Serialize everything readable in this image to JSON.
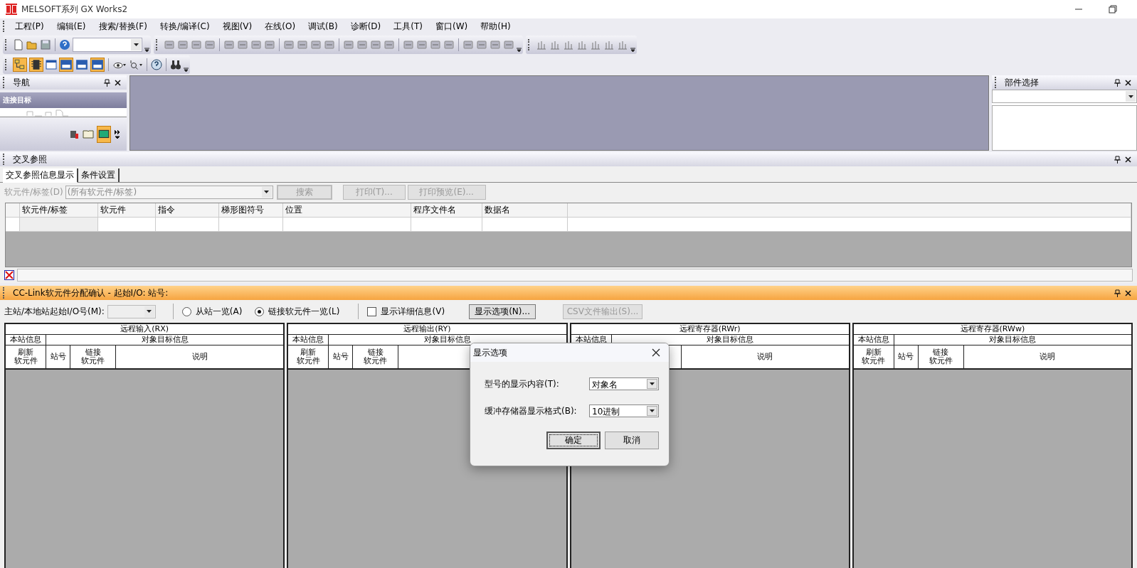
{
  "window": {
    "title": "MELSOFT系列 GX Works2"
  },
  "menu": [
    {
      "label": "工程(P)"
    },
    {
      "label": "编辑(E)"
    },
    {
      "label": "搜索/替换(F)"
    },
    {
      "label": "转换/编译(C)"
    },
    {
      "label": "视图(V)"
    },
    {
      "label": "在线(O)"
    },
    {
      "label": "调试(B)"
    },
    {
      "label": "诊断(D)"
    },
    {
      "label": "工具(T)"
    },
    {
      "label": "窗口(W)"
    },
    {
      "label": "帮助(H)"
    }
  ],
  "navigation": {
    "title": "导航",
    "section": "连接目标"
  },
  "parts_panel": {
    "title": "部件选择"
  },
  "cross_reference": {
    "title": "交叉参照",
    "tabs": [
      {
        "label": "交叉参照信息显示",
        "selected": true
      },
      {
        "label": "条件设置",
        "selected": false
      }
    ],
    "device_label": "软元件/标签(D)",
    "device_value": "(所有软元件/标签)",
    "device_disabled": true,
    "buttons": [
      {
        "label": "搜索",
        "disabled": true
      },
      {
        "label": "打印(T)...",
        "disabled": true
      },
      {
        "label": "打印预览(E)...",
        "disabled": true
      }
    ],
    "columns": [
      "软元件/标签",
      "软元件",
      "指令",
      "梯形图符号",
      "位置",
      "程序文件名",
      "数据名"
    ]
  },
  "cc_link": {
    "title": "CC-Link软元件分配确认 - 起始I/O: 站号:",
    "start_io_label": "主站/本地站起始I/O号(M):",
    "radios": [
      {
        "label": "从站一览(A)",
        "selected": false
      },
      {
        "label": "链接软元件一览(L)",
        "selected": true
      }
    ],
    "detail_checkbox": {
      "label": "显示详细信息(V)",
      "checked": false
    },
    "buttons": [
      {
        "label": "显示选项(N)...",
        "disabled": false
      },
      {
        "label": "CSV文件输出(S)...",
        "disabled": true
      }
    ],
    "tables": [
      {
        "title": "远程输入(RX)",
        "group_1": "本站信息",
        "group_2": "对象目标信息",
        "columns": [
          {
            "kind": "refresh",
            "label": "刷新软元件"
          },
          {
            "kind": "station",
            "label": "站号"
          },
          {
            "kind": "link",
            "label": "链接软元件"
          },
          {
            "kind": "note",
            "label": "说明"
          }
        ]
      },
      {
        "title": "远程输出(RY)",
        "group_1": "本站信息",
        "group_2": "对象目标信息",
        "columns": [
          {
            "kind": "refresh",
            "label": "刷新软元件"
          },
          {
            "kind": "station",
            "label": "站号"
          },
          {
            "kind": "link",
            "label": "链接软元件"
          }
        ]
      },
      {
        "title": "远程寄存器(RWr)",
        "group_1": "本站信息",
        "group_2": "对象目标信息",
        "columns": [
          {
            "kind": "note",
            "label": "说明"
          }
        ]
      },
      {
        "title": "远程寄存器(RWw)",
        "group_1": "本站信息",
        "group_2": "对象目标信息",
        "columns": [
          {
            "kind": "refresh",
            "label": "刷新软元件"
          },
          {
            "kind": "station",
            "label": "站号"
          },
          {
            "kind": "link",
            "label": "链接软元件"
          },
          {
            "kind": "note",
            "label": "说明"
          }
        ]
      }
    ]
  },
  "dialog": {
    "title": "显示选项",
    "fields": [
      {
        "label": "型号的显示内容(T):",
        "value": "对象名"
      },
      {
        "label": "缓冲存储器显示格式(B):",
        "value": "10进制"
      }
    ],
    "buttons": [
      {
        "label": "确定",
        "default": true
      },
      {
        "label": "取消",
        "default": false
      }
    ]
  }
}
